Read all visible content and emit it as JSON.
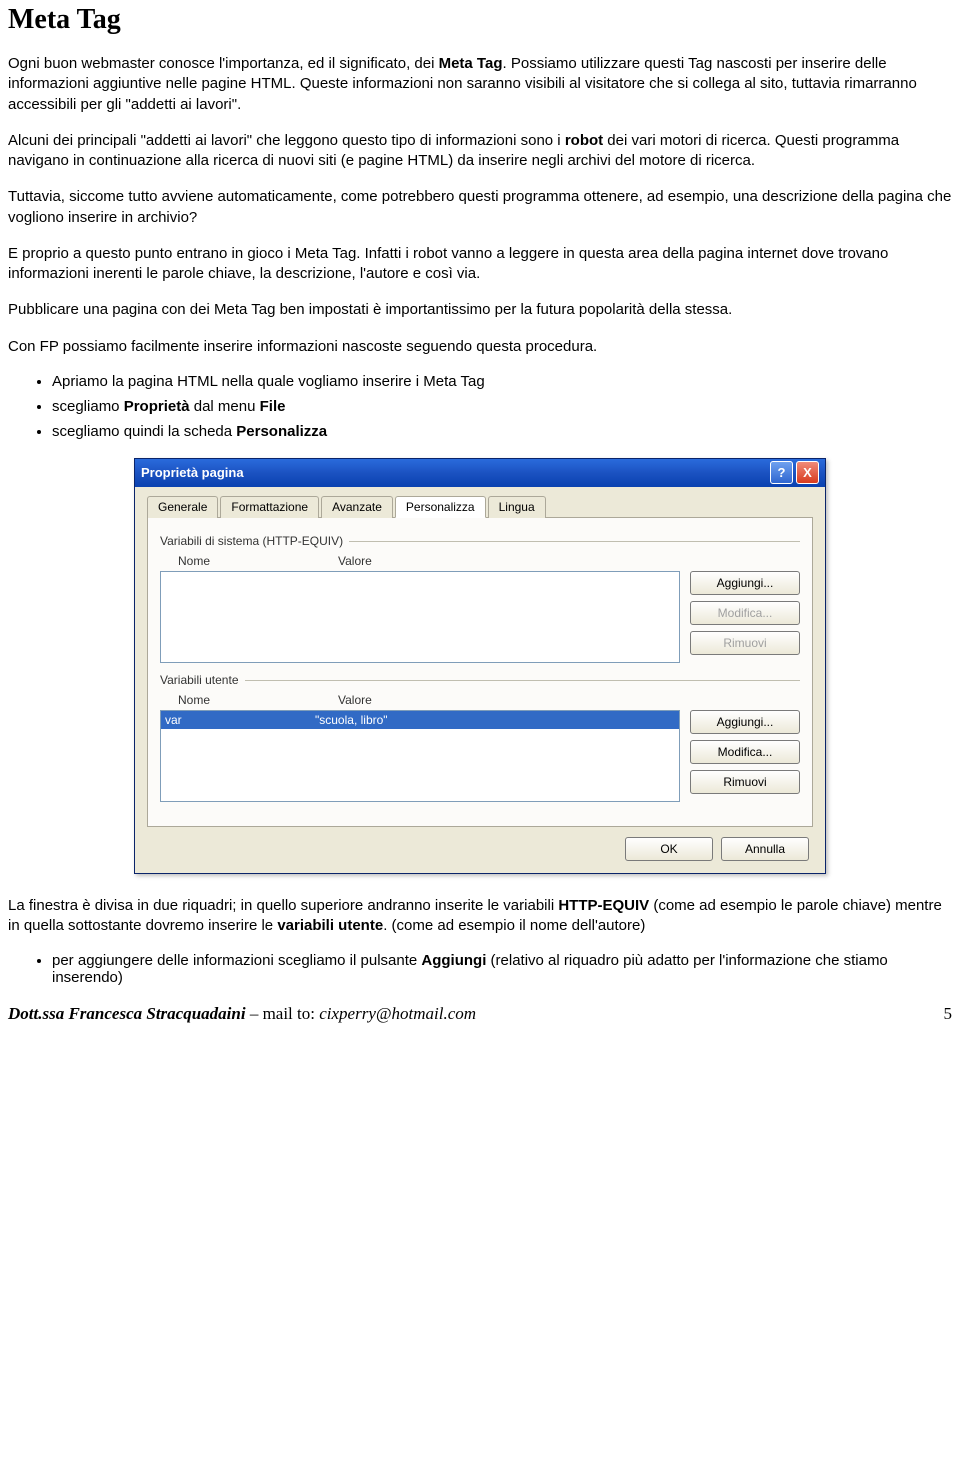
{
  "heading": "Meta Tag",
  "paragraphs": {
    "p1a": "Ogni buon webmaster conosce l'importanza, ed il significato, dei ",
    "p1b": "Meta Tag",
    "p1c": ".",
    "p2": "Possiamo utilizzare questi Tag nascosti per inserire delle informazioni aggiuntive nelle pagine HTML. Queste informazioni non saranno visibili al visitatore che si collega al sito, tuttavia rimarranno accessibili per gli \"addetti ai lavori\".",
    "p3a": "Alcuni dei principali \"addetti ai lavori\" che leggono questo tipo di informazioni sono i ",
    "p3b": "robot",
    "p3c": " dei vari motori di ricerca. Questi programma navigano in continuazione alla ricerca di nuovi siti (e pagine HTML) da inserire negli archivi del motore di ricerca.",
    "p4": "Tuttavia, siccome tutto avviene automaticamente, come potrebbero questi programma ottenere, ad esempio, una descrizione della pagina che vogliono inserire in archivio?",
    "p5": "E proprio a questo punto entrano in gioco i Meta Tag. Infatti i robot vanno a leggere in questa area della pagina internet dove trovano informazioni inerenti le parole chiave, la descrizione, l'autore e così via.",
    "p6": "Pubblicare una pagina con dei Meta Tag ben impostati è importantissimo per la futura popolarità della stessa.",
    "p7": "Con FP possiamo facilmente inserire informazioni nascoste seguendo questa procedura."
  },
  "bullets": {
    "b1": "Apriamo la pagina HTML nella quale vogliamo inserire i Meta Tag",
    "b2a": "scegliamo ",
    "b2b": "Proprietà",
    "b2c": " dal menu ",
    "b2d": "File",
    "b3a": "scegliamo quindi la scheda ",
    "b3b": "Personalizza"
  },
  "dialog": {
    "title": "Proprietà pagina",
    "help": "?",
    "close": "X",
    "tabs": {
      "generale": "Generale",
      "formattazione": "Formattazione",
      "avanzate": "Avanzate",
      "personalizza": "Personalizza",
      "lingua": "Lingua"
    },
    "group1_legend": "Variabili di sistema (HTTP-EQUIV)",
    "group2_legend": "Variabili utente",
    "col_nome": "Nome",
    "col_valore": "Valore",
    "row_name": "var",
    "row_value": "\"scuola, libro\"",
    "btn_aggiungi": "Aggiungi...",
    "btn_modifica": "Modifica...",
    "btn_rimuovi": "Rimuovi",
    "btn_ok": "OK",
    "btn_annulla": "Annulla"
  },
  "after": {
    "p8a": "La finestra è divisa in due riquadri; in quello superiore andranno inserite le variabili ",
    "p8b": "HTTP-EQUIV",
    "p8c": " (come ad esempio le parole chiave) mentre in quella sottostante dovremo inserire le ",
    "p8d": "variabili utente",
    "p8e": ". (come ad esempio il nome dell'autore)",
    "b4a": "per aggiungere delle informazioni scegliamo il pulsante ",
    "b4b": "Aggiungi",
    "b4c": " (relativo al riquadro più adatto per l'informazione che stiamo inserendo)"
  },
  "footer": {
    "author": "Dott.ssa Francesca Stracquadaini",
    "sep": " – mail to: ",
    "mail": "cixperry@hotmail.com",
    "page": "5"
  }
}
